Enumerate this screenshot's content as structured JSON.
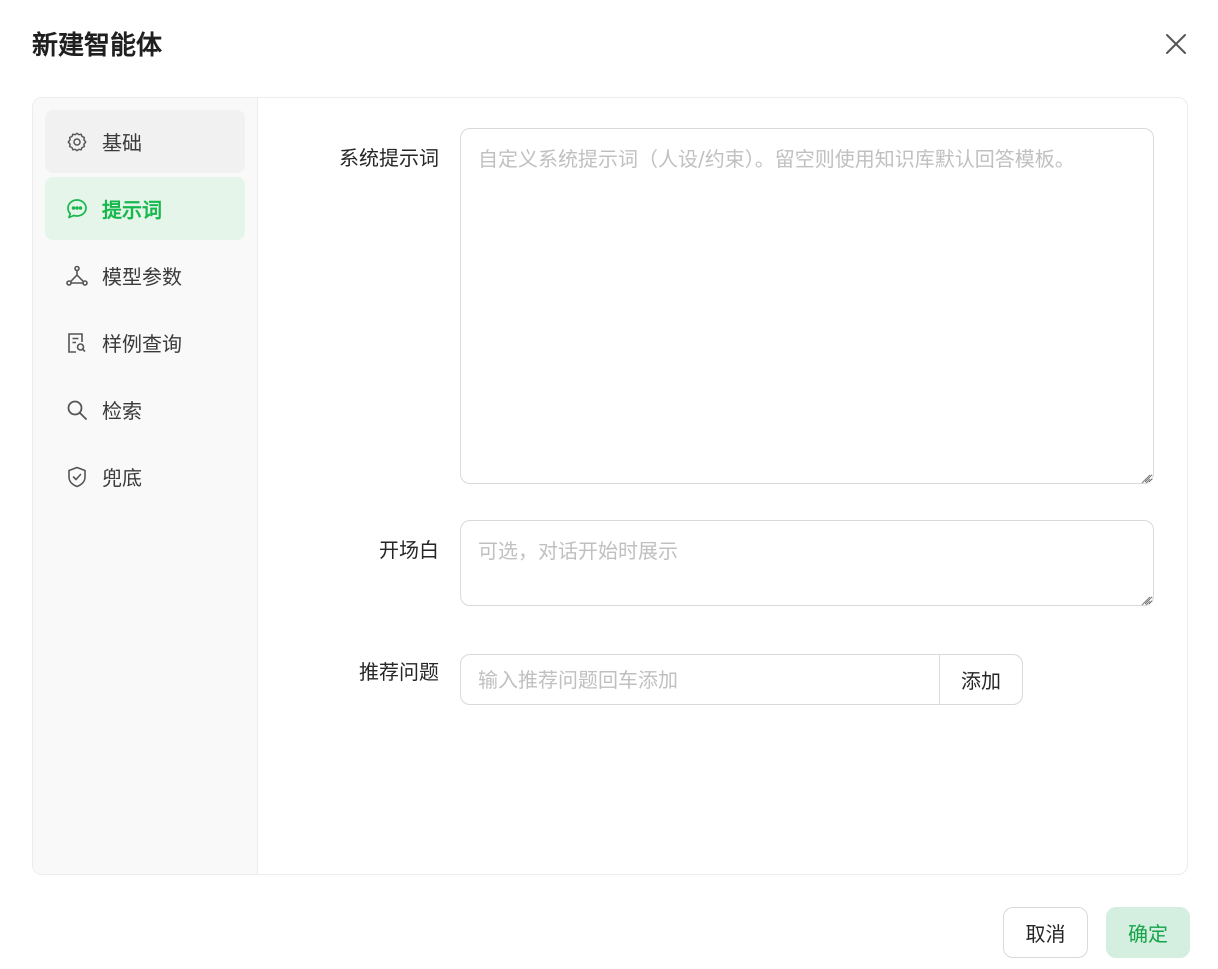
{
  "dialog": {
    "title": "新建智能体"
  },
  "sidebar": {
    "items": [
      {
        "label": "基础",
        "icon": "gear-icon",
        "state": "hover"
      },
      {
        "label": "提示词",
        "icon": "chat-icon",
        "state": "active"
      },
      {
        "label": "模型参数",
        "icon": "nodes-icon",
        "state": "normal"
      },
      {
        "label": "样例查询",
        "icon": "doc-search-icon",
        "state": "normal"
      },
      {
        "label": "检索",
        "icon": "search-icon",
        "state": "normal"
      },
      {
        "label": "兜底",
        "icon": "shield-check-icon",
        "state": "normal"
      }
    ]
  },
  "form": {
    "system_prompt": {
      "label": "系统提示词",
      "placeholder": "自定义系统提示词（人设/约束）。留空则使用知识库默认回答模板。"
    },
    "opening": {
      "label": "开场白",
      "placeholder": "可选，对话开始时展示"
    },
    "suggested_questions": {
      "label": "推荐问题",
      "placeholder": "输入推荐问题回车添加",
      "add_label": "添加"
    }
  },
  "footer": {
    "cancel_label": "取消",
    "ok_label": "确定"
  },
  "colors": {
    "accent": "#16b84e",
    "active_bg": "#e6f5e9",
    "ok_bg": "#d4efdf"
  }
}
